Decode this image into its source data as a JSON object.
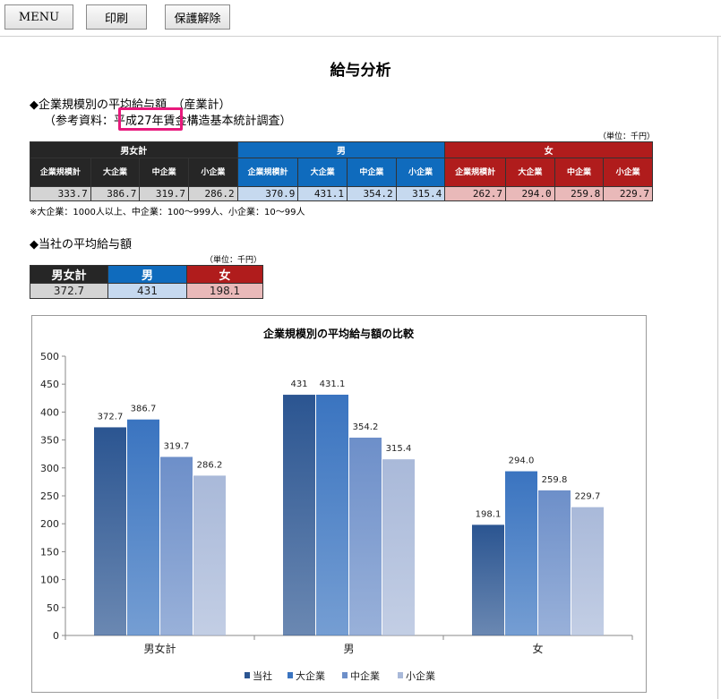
{
  "toolbar": {
    "menu": "MENU",
    "print": "印刷",
    "unprotect": "保護解除"
  },
  "title": "給与分析",
  "section1": {
    "heading": "◆企業規模別の平均給与額　（産業計）",
    "source": "（参考資料：平成27年賃金構造基本統計調査）",
    "unit": "（単位：千円）"
  },
  "table1": {
    "groups": [
      "男女計",
      "男",
      "女"
    ],
    "subheaders": [
      "企業規模計",
      "大企業",
      "中企業",
      "小企業"
    ],
    "values": [
      [
        "333.7",
        "386.7",
        "319.7",
        "286.2"
      ],
      [
        "370.9",
        "431.1",
        "354.2",
        "315.4"
      ],
      [
        "262.7",
        "294.0",
        "259.8",
        "229.7"
      ]
    ]
  },
  "note": "※大企業：1000人以上、中企業：100～999人、小企業：10～99人",
  "section2": {
    "heading": "◆当社の平均給与額",
    "unit": "（単位：千円）"
  },
  "table2": {
    "headers": [
      "男女計",
      "男",
      "女"
    ],
    "values": [
      "372.7",
      "431",
      "198.1"
    ]
  },
  "colors": {
    "black": "#262626",
    "blue": "#0f6bbd",
    "red": "#b01c1c",
    "highlight": "#e8197c"
  },
  "chart_data": {
    "type": "bar",
    "title": "企業規模別の平均給与額の比較",
    "categories": [
      "男女計",
      "男",
      "女"
    ],
    "ylim": [
      0,
      500
    ],
    "yticks": [
      0,
      50,
      100,
      150,
      200,
      250,
      300,
      350,
      400,
      450,
      500
    ],
    "grid": false,
    "legend": "bottom",
    "series": [
      {
        "name": "当社",
        "values": [
          372.7,
          431,
          198.1
        ],
        "labels": [
          "372.7",
          "431",
          "198.1"
        ],
        "color": "#2b5591"
      },
      {
        "name": "大企業",
        "values": [
          386.7,
          431.1,
          294.0
        ],
        "labels": [
          "386.7",
          "431.1",
          "294.0"
        ],
        "color": "#3a74c0"
      },
      {
        "name": "中企業",
        "values": [
          319.7,
          354.2,
          259.8
        ],
        "labels": [
          "319.7",
          "354.2",
          "259.8"
        ],
        "color": "#6d8fc9"
      },
      {
        "name": "小企業",
        "values": [
          286.2,
          315.4,
          229.7
        ],
        "labels": [
          "286.2",
          "315.4",
          "229.7"
        ],
        "color": "#a9b9d9"
      }
    ]
  }
}
